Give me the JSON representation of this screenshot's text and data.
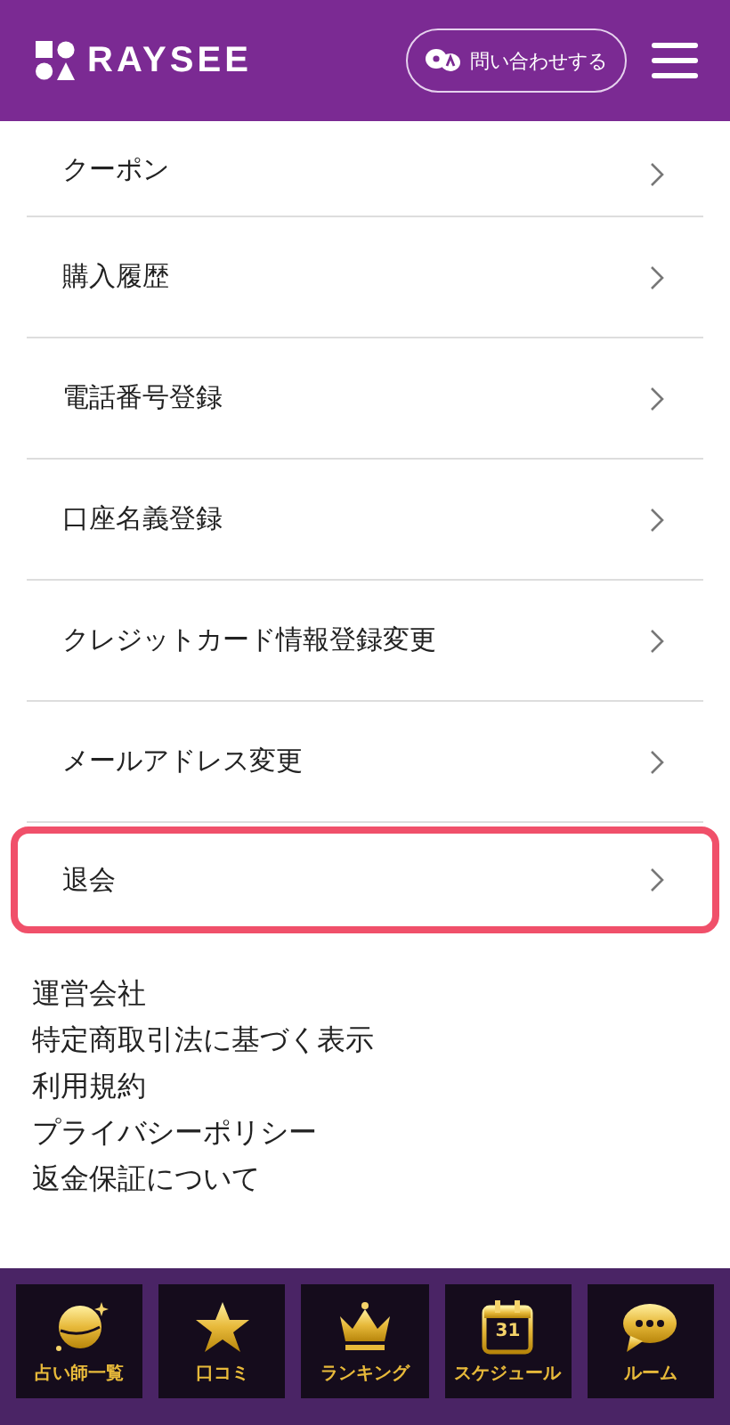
{
  "header": {
    "logo": "RAYSEE",
    "contact_button": "問い合わせする"
  },
  "menu_items": [
    {
      "label": "クーポン",
      "highlighted": false
    },
    {
      "label": "購入履歴",
      "highlighted": false
    },
    {
      "label": "電話番号登録",
      "highlighted": false
    },
    {
      "label": "口座名義登録",
      "highlighted": false
    },
    {
      "label": "クレジットカード情報登録変更",
      "highlighted": false
    },
    {
      "label": "メールアドレス変更",
      "highlighted": false
    },
    {
      "label": "退会",
      "highlighted": true
    }
  ],
  "footer_links": [
    "運営会社",
    "特定商取引法に基づく表示",
    "利用規約",
    "プライバシーポリシー",
    "返金保証について"
  ],
  "bottom_nav": [
    {
      "kind": "planet",
      "label": "占い師一覧"
    },
    {
      "kind": "star",
      "label": "口コミ"
    },
    {
      "kind": "crown",
      "label": "ランキング"
    },
    {
      "kind": "calendar",
      "label": "スケジュール",
      "icon_text": "31"
    },
    {
      "kind": "chat",
      "label": "ルーム"
    }
  ]
}
